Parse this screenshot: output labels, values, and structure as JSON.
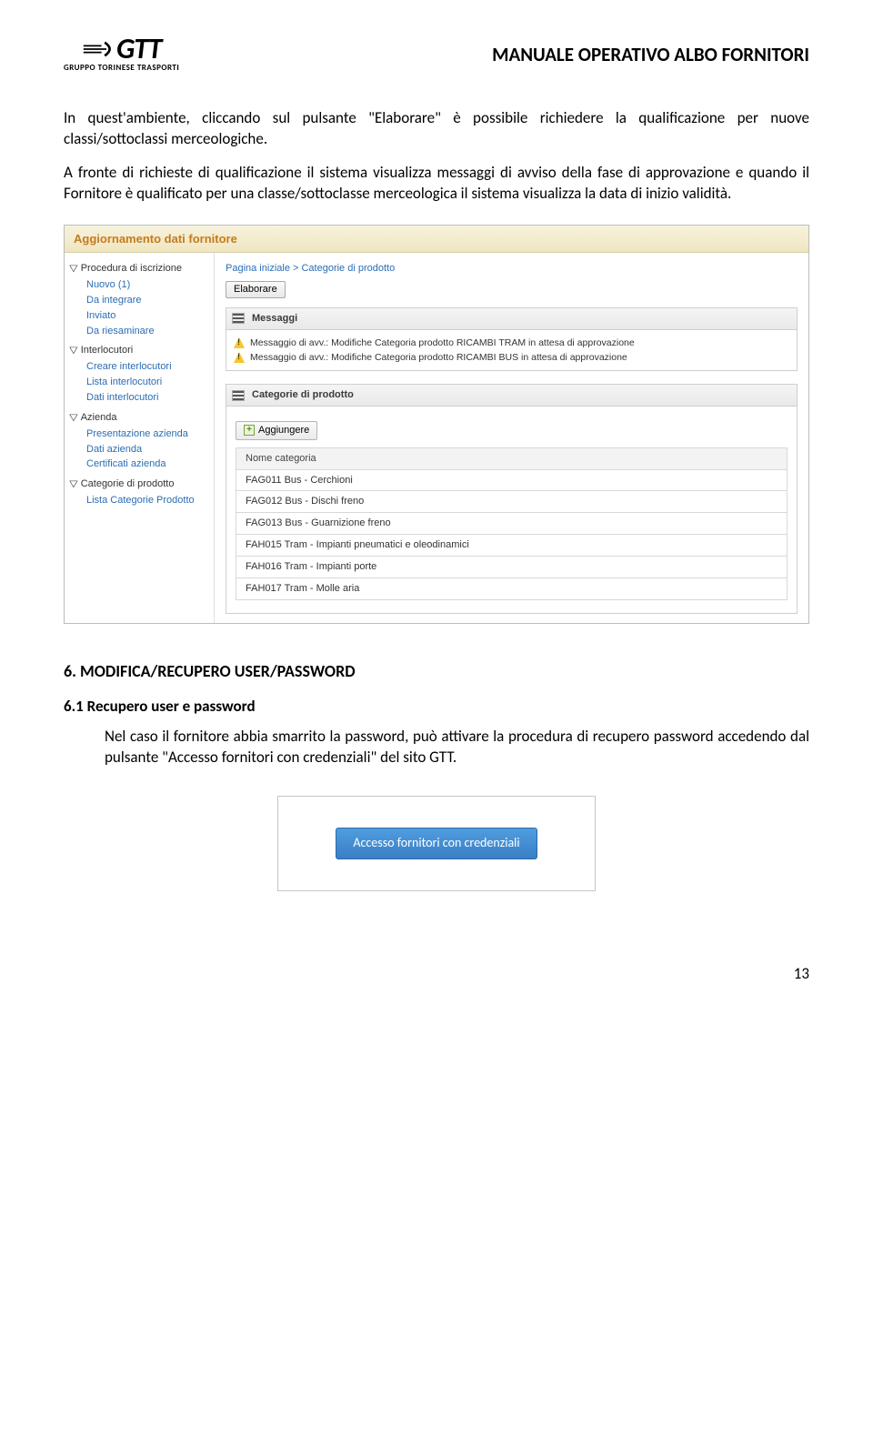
{
  "header": {
    "logo_main": "GTT",
    "logo_sub": "GRUPPO TORINESE TRASPORTI",
    "doc_title": "MANUALE OPERATIVO ALBO FORNITORI"
  },
  "paragraphs": {
    "p1": "In quest'ambiente, cliccando sul pulsante \"Elaborare\" è possibile richiedere la qualificazione per nuove classi/sottoclassi merceologiche.",
    "p2": "A fronte di richieste di qualificazione il sistema visualizza messaggi di avviso della fase di approvazione e quando il Fornitore è qualificato per una classe/sottoclasse merceologica il sistema visualizza la data di inizio validità."
  },
  "screenshot": {
    "topbar": "Aggiornamento dati fornitore",
    "breadcrumb": "Pagina iniziale > Categorie di prodotto",
    "elaborare_label": "Elaborare",
    "messaggi_header": "Messaggi",
    "messages": [
      "Messaggio di avv.: Modifiche Categoria prodotto RICAMBI TRAM in attesa di approvazione",
      "Messaggio di avv.: Modifiche Categoria prodotto RICAMBI BUS in attesa di approvazione"
    ],
    "categorie_header": "Categorie di prodotto",
    "aggiungere_label": "Aggiungere",
    "table_header": "Nome categoria",
    "table_rows": [
      "FAG011 Bus - Cerchioni",
      "FAG012 Bus - Dischi freno",
      "FAG013 Bus - Guarnizione freno",
      "FAH015 Tram - Impianti pneumatici e oleodinamici",
      "FAH016 Tram - Impianti porte",
      "FAH017 Tram - Molle aria"
    ],
    "sidebar": {
      "groups": [
        {
          "title": "Procedura di iscrizione",
          "items": [
            "Nuovo (1)",
            "Da integrare",
            "Inviato",
            "Da riesaminare"
          ]
        },
        {
          "title": "Interlocutori",
          "items": [
            "Creare interlocutori",
            "Lista interlocutori",
            "Dati interlocutori"
          ]
        },
        {
          "title": "Azienda",
          "items": [
            "Presentazione azienda",
            "Dati azienda",
            "Certificati azienda"
          ]
        },
        {
          "title": "Categorie di prodotto",
          "items": [
            "Lista Categorie Prodotto"
          ]
        }
      ]
    }
  },
  "section6": {
    "title": "6. MODIFICA/RECUPERO USER/PASSWORD",
    "sub_title": "6.1 Recupero user e password",
    "body": "Nel caso il fornitore abbia smarrito la password, può attivare la procedura di recupero password accedendo dal pulsante \"Accesso fornitori con credenziali\" del sito GTT.",
    "login_button": "Accesso fornitori con credenziali"
  },
  "page_number": "13"
}
